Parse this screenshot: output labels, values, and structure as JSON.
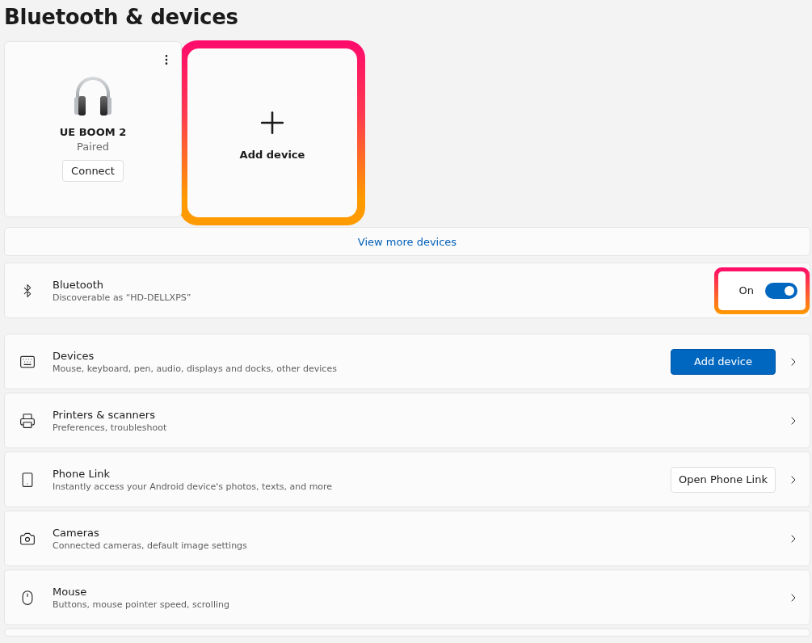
{
  "title": "Bluetooth & devices",
  "device_cards": [
    {
      "name": "UE BOOM 2",
      "status": "Paired",
      "action": "Connect"
    }
  ],
  "add_card": {
    "label": "Add device",
    "highlighted": true
  },
  "view_more": "View more devices",
  "bluetooth": {
    "title": "Bluetooth",
    "subtitle": "Discoverable as “HD-DELLXPS”",
    "state_label": "On",
    "on": true,
    "highlighted": true
  },
  "rows": [
    {
      "title": "Devices",
      "subtitle": "Mouse, keyboard, pen, audio, displays and docks, other devices",
      "action": {
        "kind": "primary",
        "label": "Add device"
      }
    },
    {
      "title": "Printers & scanners",
      "subtitle": "Preferences, troubleshoot"
    },
    {
      "title": "Phone Link",
      "subtitle": "Instantly access your Android device's photos, texts, and more",
      "action": {
        "kind": "secondary",
        "label": "Open Phone Link"
      }
    },
    {
      "title": "Cameras",
      "subtitle": "Connected cameras, default image settings"
    },
    {
      "title": "Mouse",
      "subtitle": "Buttons, mouse pointer speed, scrolling"
    }
  ]
}
